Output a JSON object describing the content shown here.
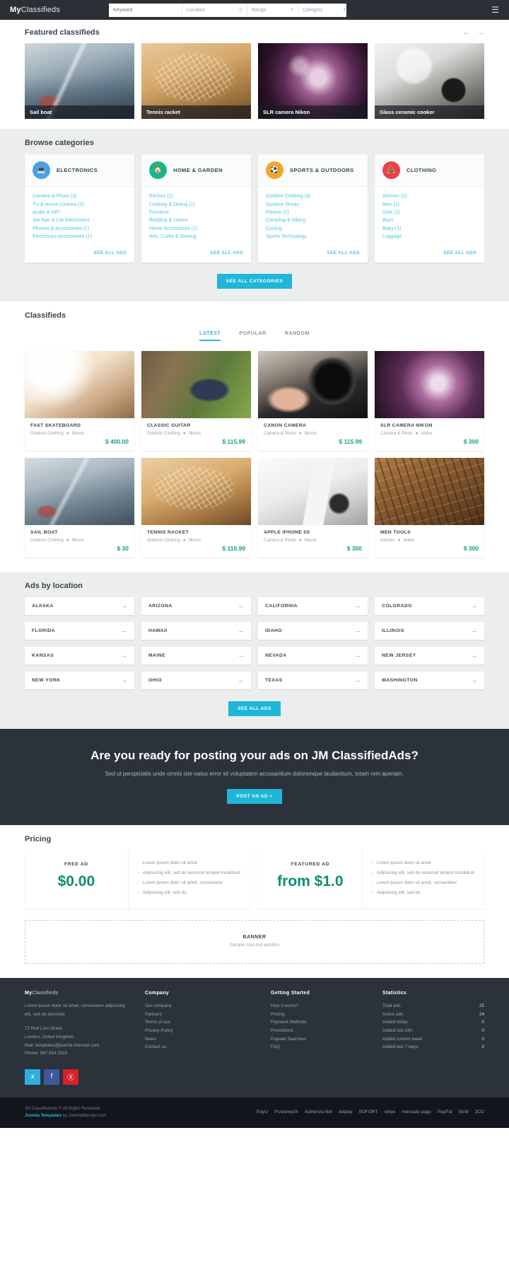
{
  "header": {
    "brand_bold": "My",
    "brand_light": "Classifieds",
    "search": {
      "keyword_placeholder": "Keyword",
      "location_placeholder": "Location",
      "range_placeholder": "Range",
      "category_placeholder": "Category",
      "search_icon": "search-icon",
      "locate_icon": "crosshair-icon",
      "caret_icon": "chevron-down-icon"
    },
    "menu_icon": "hamburger-icon"
  },
  "featured": {
    "title": "Featured classifieds",
    "prev": "←",
    "next": "→",
    "items": [
      {
        "caption": "Sail boat"
      },
      {
        "caption": "Tennis racket"
      },
      {
        "caption": "SLR camera Nikon"
      },
      {
        "caption": "Glass ceramic cooker"
      }
    ]
  },
  "categories": {
    "title": "Browse categories",
    "see_all_label": "SEE ALL ADS",
    "see_all_categories": "SEE ALL CATEGORIES",
    "cards": [
      {
        "name": "ELECTRONICS",
        "color": "#4a9fe8",
        "icon": "laptop-icon",
        "links": [
          "Camera & Photo (3)",
          "TV & Home Cinema (2)",
          "Audio & HiFi",
          "Sat Nav & Car Electronics",
          "Phones & Accessories (1)",
          "Electronics Accessories (1)"
        ]
      },
      {
        "name": "HOME & GARDEN",
        "color": "#13b98a",
        "icon": "home-icon",
        "links": [
          "Kitchen (2)",
          "Cooking & Dining (1)",
          "Furniture",
          "Bedding & Linens",
          "Home Accessories (1)",
          "Arts, Crafts & Sewing"
        ]
      },
      {
        "name": "SPORTS & OUTDOORS",
        "color": "#f5a623",
        "icon": "soccer-ball-icon",
        "links": [
          "Outdoor Clothing (4)",
          "Outdoor Shoes",
          "Fitness (2)",
          "Camping & Hiking",
          "Cycling",
          "Sports Technology"
        ]
      },
      {
        "name": "CLOTHING",
        "color": "#e8414c",
        "icon": "handbag-icon",
        "links": [
          "Women (2)",
          "Men (1)",
          "Girls (2)",
          "Boys",
          "Baby (1)",
          "Luggage"
        ]
      }
    ]
  },
  "classifieds": {
    "title": "Classifieds",
    "tabs": [
      {
        "label": "LATEST",
        "active": true
      },
      {
        "label": "POPULAR",
        "active": false
      },
      {
        "label": "RANDOM",
        "active": false
      }
    ],
    "items": [
      {
        "name": "FAST SKATEBOARD",
        "category": "Outdoor Clothing",
        "location": "Illinois",
        "price": "$ 400.00"
      },
      {
        "name": "CLASSIC GUITAR",
        "category": "Outdoor Clothing",
        "location": "Illinois",
        "price": "$ 115.99"
      },
      {
        "name": "CANON CAMERA",
        "category": "Camera & Photo",
        "location": "Illinois",
        "price": "$ 115.99"
      },
      {
        "name": "SLR CAMERA NIKON",
        "category": "Camera & Photo",
        "location": "Idaho",
        "price": "$ 300"
      },
      {
        "name": "SAIL BOAT",
        "category": "Outdoor Clothing",
        "location": "Illinois",
        "price": "$ 30"
      },
      {
        "name": "TENNIS RACKET",
        "category": "Outdoor Clothing",
        "location": "Illinois",
        "price": "$ 115.99"
      },
      {
        "name": "APPLE IPHONE 5S",
        "category": "Camera & Photo",
        "location": "Maine",
        "price": "$ 300"
      },
      {
        "name": "MEN TOOLS",
        "category": "Kitchen",
        "location": "Idaho",
        "price": "$ 300"
      }
    ]
  },
  "locations": {
    "title": "Ads by location",
    "see_all_ads": "SEE ALL ADS",
    "arrow_icon": "arrow-right-icon",
    "items": [
      "ALASKA",
      "ARIZONA",
      "CALIFORNIA",
      "COLORADO",
      "FLORIDA",
      "HAWAII",
      "IDAHO",
      "ILLINOIS",
      "KANSAS",
      "MAINE",
      "NEVADA",
      "NEW JERSEY",
      "NEW YORK",
      "OHIO",
      "TEXAS",
      "WASHINGTON"
    ]
  },
  "cta": {
    "heading": "Are you ready for posting your ads on JM ClassifiedAds?",
    "subtext": "Sed ut perspiciatis unde omnis iste natus error sit voluptatem accusantium doloremque laudantium, totam rem aperiam.",
    "button": "POST AN AD +"
  },
  "pricing": {
    "title": "Pricing",
    "plans": [
      {
        "name": "FREE AD",
        "amount": "$0.00",
        "features": [
          "Lorem ipsum dolor sit amet",
          "Adipiscing elit, sed do eiusmod tempor incididunt",
          "Lorem ipsum dolor sit amet, consectetur",
          "Adipiscing elit, sed do"
        ]
      },
      {
        "name": "FEATURED AD",
        "amount": "from $1.0",
        "features": [
          "Lorem ipsum dolor sit amet",
          "Adipiscing elit, sed do eiusmod tempor incididunt",
          "Lorem ipsum dolor sit amet, consectetur",
          "Adipiscing elit, sed do"
        ]
      }
    ]
  },
  "banner": {
    "title": "BANNER",
    "subtitle": "Sample size and position"
  },
  "footer": {
    "about": {
      "brand_bold": "My",
      "brand_light": "Classifieds",
      "text": "Lorem ipsum dolor sit amet, consectetur adipiscing elit, sed do eiusmod.",
      "address1": "72 Red Lion Street,",
      "address2": "London, United Kingdom",
      "mail": "Mail: templates@joomla-monster.com",
      "phone": "Phone: 987 654 2010"
    },
    "company": {
      "title": "Company",
      "links": [
        "Our company",
        "Partners",
        "Terms of use",
        "Privacy Policy",
        "News",
        "Contact us"
      ]
    },
    "getting_started": {
      "title": "Getting Started",
      "links": [
        "How it works?",
        "Pricing",
        "Payment Methods",
        "Promotions",
        "Popular Searches",
        "FAQ"
      ]
    },
    "statistics": {
      "title": "Statistics",
      "rows": [
        {
          "label": "Total ads:",
          "value": "25"
        },
        {
          "label": "Active ads:",
          "value": "24"
        },
        {
          "label": "Added today:",
          "value": "0"
        },
        {
          "label": "Added last 24h:",
          "value": "0"
        },
        {
          "label": "Added current week:",
          "value": "0"
        },
        {
          "label": "Added last 7 days:",
          "value": "0"
        }
      ]
    },
    "socials": [
      {
        "name": "twitter",
        "glyph": "t"
      },
      {
        "name": "facebook",
        "glyph": "f"
      },
      {
        "name": "pinterest",
        "glyph": "p"
      }
    ],
    "copyright_line1": "JM ClassifiedAds © All Rights Reserved",
    "copyright_link": "Joomla Templates",
    "copyright_line2": " by JoomlaMonster.com",
    "payments": [
      "PayU",
      "Przelewy24",
      "Authorize.Net",
      "dotpay",
      "SOFORT",
      "stripe",
      "mercado pago",
      "PayPal",
      "Skrill",
      "2CO"
    ]
  }
}
